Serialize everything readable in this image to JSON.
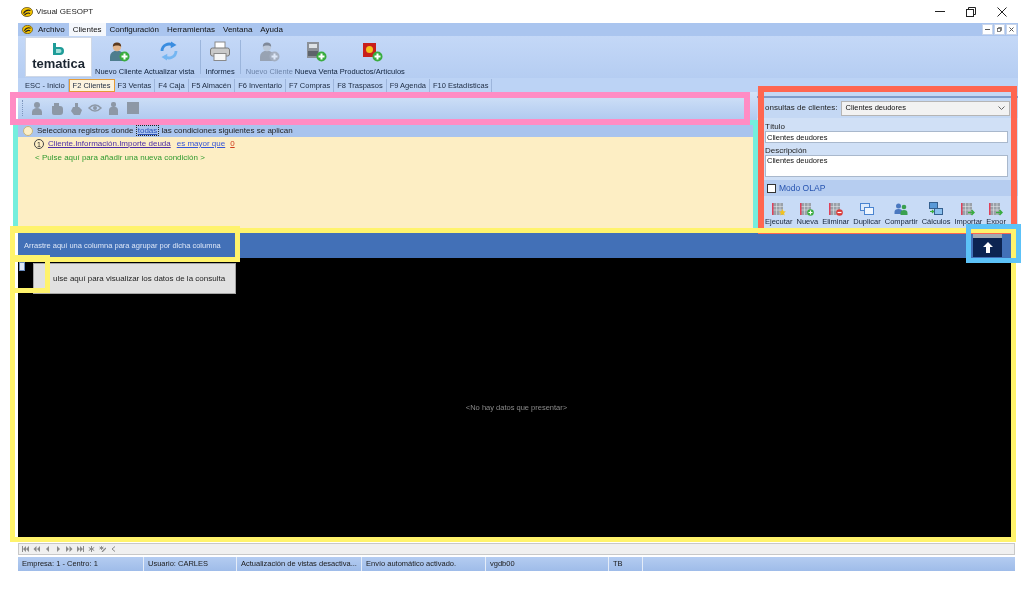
{
  "window": {
    "title": "Visual GESOPT"
  },
  "menu": [
    {
      "label": "Archivo",
      "selected": false
    },
    {
      "label": "Clientes",
      "selected": true
    },
    {
      "label": "Configuración",
      "selected": false
    },
    {
      "label": "Herramientas",
      "selected": false
    },
    {
      "label": "Ventana",
      "selected": false
    },
    {
      "label": "Ayuda",
      "selected": false
    }
  ],
  "ribbon": {
    "logo": "tematica",
    "groups": [
      {
        "buttons": [
          {
            "label": "Nuevo Cliente",
            "disabled": false
          },
          {
            "label": "Actualizar vista",
            "disabled": false
          }
        ]
      },
      {
        "buttons": [
          {
            "label": "Informes",
            "disabled": false
          }
        ]
      },
      {
        "buttons": [
          {
            "label": "Nuevo Cliente",
            "disabled": true
          },
          {
            "label": "Nueva Venta",
            "disabled": false
          },
          {
            "label": "Productos/Artículos",
            "disabled": false
          }
        ]
      }
    ]
  },
  "tabs": [
    {
      "label": "ESC - Inicio",
      "selected": false
    },
    {
      "label": "F2 Clientes",
      "selected": true
    },
    {
      "label": "F3 Ventas",
      "selected": false
    },
    {
      "label": "F4 Caja",
      "selected": false
    },
    {
      "label": "F5 Almacén",
      "selected": false
    },
    {
      "label": "F6 Inventario",
      "selected": false
    },
    {
      "label": "F7 Compras",
      "selected": false
    },
    {
      "label": "F8 Traspasos",
      "selected": false
    },
    {
      "label": "F9 Agenda",
      "selected": false
    },
    {
      "label": "F10 Estadísticas",
      "selected": false
    }
  ],
  "condition_toolbar": {
    "highlighted": true,
    "buttons": [
      {
        "disabled": true
      },
      {
        "disabled": true
      },
      {
        "disabled": true
      },
      {
        "disabled": true
      },
      {
        "disabled": true
      },
      {
        "disabled": true
      }
    ]
  },
  "condition_editor": {
    "highlighted": true,
    "sentence_before": "Selecciona registros donde",
    "quantifier": "todas",
    "sentence_after": "las condiciones siguientes se aplican",
    "conditions": [
      {
        "number": "1",
        "field": "Cliente.Información.Importe deuda",
        "operator": "es mayor que",
        "value": "0"
      }
    ],
    "add_hint": "< Pulse aquí para añadir una nueva condición >"
  },
  "query_panel": {
    "highlighted": true,
    "query_label": "onsultas de clientes:",
    "query_value": "Clientes deudores",
    "title_label": "Título",
    "title_value": "Clientes deudores",
    "description_label": "Descripción",
    "description_value": "Clientes deudores",
    "olap": {
      "label": "Modo OLAP",
      "checked": false
    },
    "actions": [
      {
        "label": "Ejecutar"
      },
      {
        "label": "Nueva"
      },
      {
        "label": "Eliminar"
      },
      {
        "label": "Duplicar"
      },
      {
        "label": "Compartir"
      },
      {
        "label": "Cálculos"
      },
      {
        "label": "Importar"
      },
      {
        "label": "Expor"
      }
    ]
  },
  "grid": {
    "highlighted": true,
    "group_bar": {
      "highlighted": true,
      "hint": "Arrastre aquí una columna para agrupar por dicha columna"
    },
    "collapse_button": {
      "highlighted": true
    },
    "load_hint": {
      "highlighted": true,
      "text": "ulse aquí para visualizar los datos de la consulta"
    },
    "empty_text": "<No hay datos que presentar>"
  },
  "status_bar": [
    {
      "text": "Empresa: 1 - Centro: 1"
    },
    {
      "text": "Usuario: CARLES"
    },
    {
      "text": "Actualización de vistas desactiva..."
    },
    {
      "text": "Envío automático activado."
    },
    {
      "text": "vgdb00"
    },
    {
      "text": "TB"
    }
  ]
}
